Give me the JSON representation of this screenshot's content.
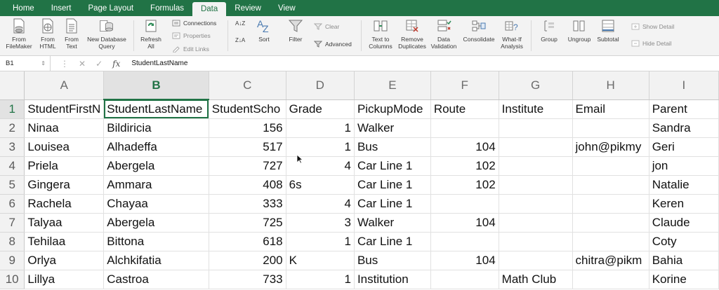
{
  "ribbon_tabs": [
    "Home",
    "Insert",
    "Page Layout",
    "Formulas",
    "Data",
    "Review",
    "View"
  ],
  "active_tab": "Data",
  "ribbon": {
    "from_filemaker": [
      "From",
      "FileMaker"
    ],
    "from_html": [
      "From",
      "HTML"
    ],
    "from_text": [
      "From",
      "Text"
    ],
    "new_db_query": [
      "New Database",
      "Query"
    ],
    "refresh_all": [
      "Refresh",
      "All"
    ],
    "connections": "Connections",
    "properties": "Properties",
    "edit_links": "Edit Links",
    "sort": "Sort",
    "filter": "Filter",
    "clear": "Clear",
    "advanced": "Advanced",
    "text_to_columns": [
      "Text to",
      "Columns"
    ],
    "remove_duplicates": [
      "Remove",
      "Duplicates"
    ],
    "data_validation": [
      "Data",
      "Validation"
    ],
    "consolidate": "Consolidate",
    "what_if": [
      "What-If",
      "Analysis"
    ],
    "group": "Group",
    "ungroup": "Ungroup",
    "subtotal": "Subtotal",
    "show_detail": "Show Detail",
    "hide_detail": "Hide Detail"
  },
  "formula_bar": {
    "name_box": "B1",
    "fx": "fx",
    "value": "StudentLastName"
  },
  "colors": {
    "accent": "#217346",
    "ribbon_bg": "#f3f3f3"
  },
  "columns": [
    "A",
    "B",
    "C",
    "D",
    "E",
    "F",
    "G",
    "H",
    "I"
  ],
  "selected_column": "B",
  "rows": [
    {
      "n": "1",
      "cells": [
        "StudentFirstN",
        "StudentLastName",
        "StudentScho",
        "Grade",
        "PickupMode",
        "Route",
        "Institute",
        "Email",
        "Parent"
      ]
    },
    {
      "n": "2",
      "cells": [
        "Ninaa",
        "Bildiricia",
        "156",
        "1",
        "Walker",
        "",
        "",
        "",
        "Sandra"
      ]
    },
    {
      "n": "3",
      "cells": [
        "Louisea",
        "Alhadeffa",
        "517",
        "1",
        "Bus",
        "104",
        "",
        "john@pikmy",
        "Geri"
      ]
    },
    {
      "n": "4",
      "cells": [
        "Priela",
        "Abergela",
        "727",
        "4",
        "Car Line 1",
        "102",
        "",
        "",
        "jon"
      ]
    },
    {
      "n": "5",
      "cells": [
        "Gingera",
        "Ammara",
        "408",
        "6s",
        "Car Line 1",
        "102",
        "",
        "",
        "Natalie"
      ]
    },
    {
      "n": "6",
      "cells": [
        "Rachela",
        "Chayaa",
        "333",
        "4",
        "Car Line 1",
        "",
        "",
        "",
        "Keren"
      ]
    },
    {
      "n": "7",
      "cells": [
        "Talyaa",
        "Abergela",
        "725",
        "3",
        "Walker",
        "104",
        "",
        "",
        "Claude"
      ]
    },
    {
      "n": "8",
      "cells": [
        "Tehilaa",
        "Bittona",
        "618",
        "1",
        "Car Line 1",
        "",
        "",
        "",
        "Coty"
      ]
    },
    {
      "n": "9",
      "cells": [
        "Orlya",
        "Alchkifatia",
        "200",
        "K",
        "Bus",
        "104",
        "",
        "chitra@pikm",
        "Bahia"
      ]
    },
    {
      "n": "10",
      "cells": [
        "Lillya",
        "Castroa",
        "733",
        "1",
        "Institution",
        "",
        "Math Club",
        "",
        "Korine"
      ]
    }
  ]
}
